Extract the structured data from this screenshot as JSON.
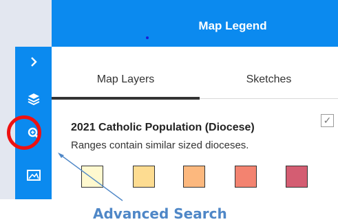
{
  "header": {
    "title": "Map Legend"
  },
  "tabs": [
    {
      "label": "Map Layers",
      "active": true
    },
    {
      "label": "Sketches",
      "active": false
    }
  ],
  "sidebar": {
    "items": [
      {
        "icon": "chevron-right-icon"
      },
      {
        "icon": "layers-icon"
      },
      {
        "icon": "search-zoom-icon"
      },
      {
        "icon": "map-image-icon"
      }
    ]
  },
  "layer": {
    "title": "2021 Catholic Population (Diocese)",
    "description": "Ranges contain similar sized dioceses.",
    "checked": true,
    "check_glyph": "✓",
    "swatches": [
      "#fff9cf",
      "#fddc91",
      "#fcb87e",
      "#f38370",
      "#d45d72"
    ]
  },
  "annotation": {
    "label": "Advanced Search",
    "ring_color": "#ee1111",
    "label_color": "#4f87c7"
  },
  "colors": {
    "accent": "#0b8aef",
    "sidebar_bg": "#e3e7f0"
  }
}
